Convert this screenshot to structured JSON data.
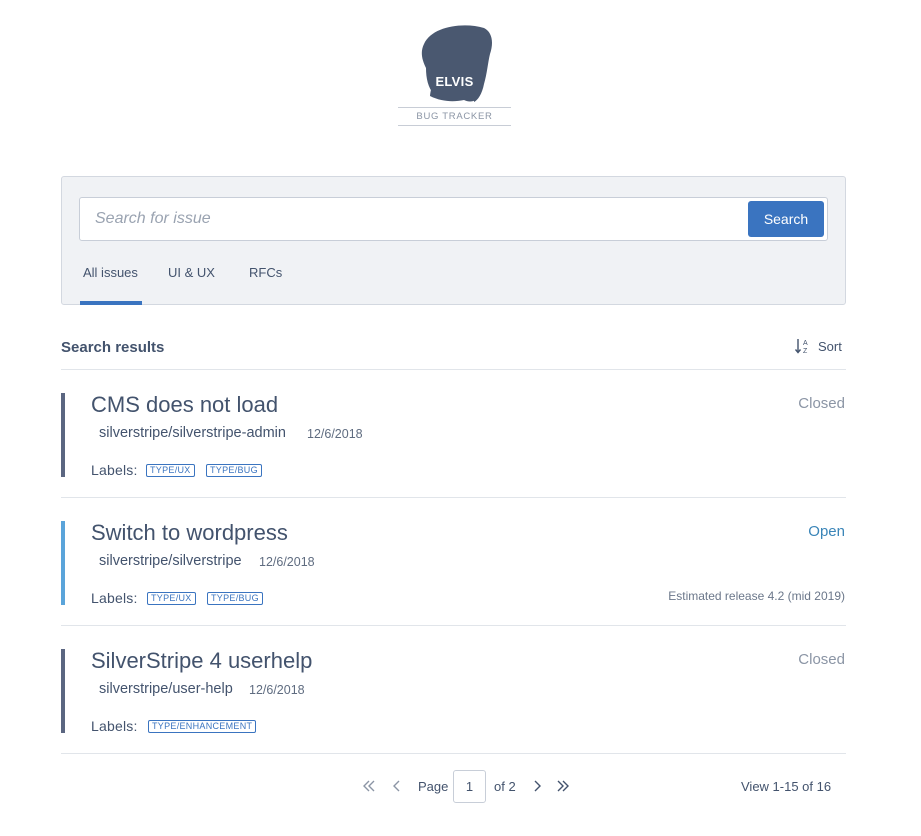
{
  "logo": {
    "name": "ELVIS",
    "subtitle": "BUG TRACKER",
    "color": "#4a5870"
  },
  "search": {
    "placeholder": "Search for issue",
    "value": "",
    "button_label": "Search"
  },
  "tabs": [
    {
      "label": "All issues",
      "active": true
    },
    {
      "label": "UI & UX",
      "active": false
    },
    {
      "label": "RFCs",
      "active": false
    }
  ],
  "results": {
    "title": "Search results",
    "sort_label": "Sort",
    "labels_prefix": "Labels:"
  },
  "issues": [
    {
      "title": "CMS does not load",
      "repo": "silverstripe/silverstripe-admin",
      "date": "12/6/2018",
      "status": "Closed",
      "labels": [
        "TYPE/UX",
        "TYPE/BUG"
      ],
      "release": ""
    },
    {
      "title": "Switch to wordpress",
      "repo": "silverstripe/silverstripe",
      "date": "12/6/2018",
      "status": "Open",
      "labels": [
        "TYPE/UX",
        "TYPE/BUG"
      ],
      "release": "Estimated release 4.2 (mid 2019)"
    },
    {
      "title": "SilverStripe 4 userhelp",
      "repo": "silverstripe/user-help",
      "date": "12/6/2018",
      "status": "Closed",
      "labels": [
        "TYPE/ENHANCEMENT"
      ],
      "release": ""
    }
  ],
  "pagination": {
    "page_label": "Page",
    "current_page": "1",
    "of_label": "of 2",
    "view_count": "View 1-15 of 16"
  },
  "colors": {
    "accent": "#3a74c0",
    "closed_bar": "#5b6681",
    "open_bar": "#5aa4da",
    "closed_text": "#8b95a5",
    "open_text": "#3a85b8",
    "panel_bg": "#f0f2f5"
  },
  "icons": {
    "sort": "sort-alpha-icon",
    "first": "double-chevron-left-icon",
    "prev": "chevron-left-icon",
    "next": "chevron-right-icon",
    "last": "double-chevron-right-icon"
  }
}
